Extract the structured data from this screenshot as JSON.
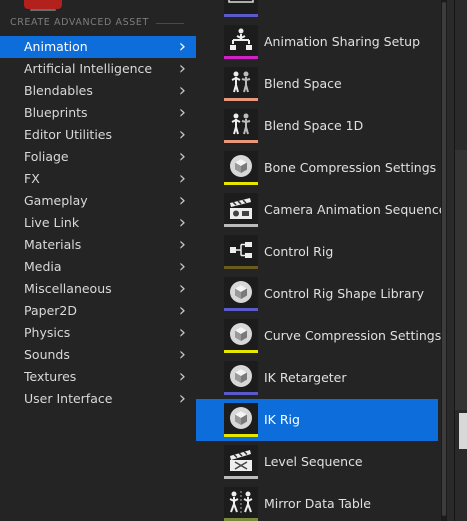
{
  "header": {
    "section_title": "CREATE ADVANCED ASSET"
  },
  "categories": [
    {
      "label": "Animation",
      "selected": true
    },
    {
      "label": "Artificial Intelligence"
    },
    {
      "label": "Blendables"
    },
    {
      "label": "Blueprints"
    },
    {
      "label": "Editor Utilities"
    },
    {
      "label": "Foliage"
    },
    {
      "label": "FX"
    },
    {
      "label": "Gameplay"
    },
    {
      "label": "Live Link"
    },
    {
      "label": "Materials"
    },
    {
      "label": "Media"
    },
    {
      "label": "Miscellaneous"
    },
    {
      "label": "Paper2D"
    },
    {
      "label": "Physics"
    },
    {
      "label": "Sounds"
    },
    {
      "label": "Textures"
    },
    {
      "label": "User Interface"
    }
  ],
  "assets": [
    {
      "label": "",
      "icon": "film-icon",
      "color": "#5a5acb"
    },
    {
      "label": "Animation Sharing Setup",
      "icon": "hierarchy-figure-icon",
      "color": "#d020c8"
    },
    {
      "label": "Blend Space",
      "icon": "figures-blend-icon",
      "color": "#e8977a"
    },
    {
      "label": "Blend Space 1D",
      "icon": "figures-blend-icon",
      "color": "#e8977a"
    },
    {
      "label": "Bone Compression Settings",
      "icon": "cube-icon",
      "color": "#e6e600"
    },
    {
      "label": "Camera Animation Sequence",
      "icon": "camera-clapper-icon",
      "color": "#bbbbbb"
    },
    {
      "label": "Control Rig",
      "icon": "rig-nodes-icon",
      "color": "#6b5a1e"
    },
    {
      "label": "Control Rig Shape Library",
      "icon": "cube-icon",
      "color": "#5a5acb"
    },
    {
      "label": "Curve Compression Settings",
      "icon": "cube-icon",
      "color": "#e6e600"
    },
    {
      "label": "IK Retargeter",
      "icon": "cube-icon",
      "color": "#5a5acb"
    },
    {
      "label": "IK Rig",
      "icon": "cube-icon",
      "color": "#e6e600",
      "selected": true
    },
    {
      "label": "Level Sequence",
      "icon": "clapperboard-icon",
      "color": "#bbbbbb"
    },
    {
      "label": "Mirror Data Table",
      "icon": "mirror-figures-icon",
      "color": "#7a8a3a"
    }
  ]
}
